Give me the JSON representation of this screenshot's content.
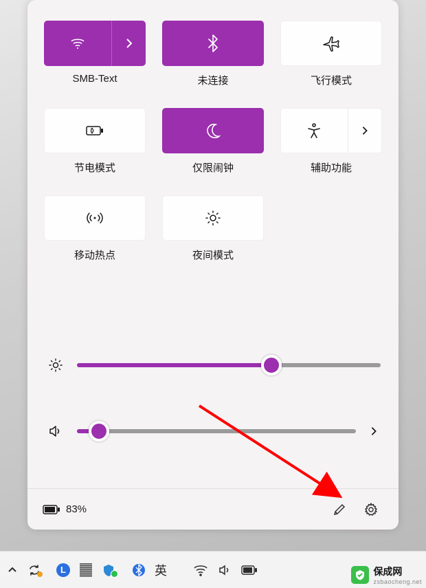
{
  "tiles": [
    {
      "label": "SMB-Text",
      "icon": "wifi",
      "state": "on",
      "split": true
    },
    {
      "label": "未连接",
      "icon": "bluetooth",
      "state": "on",
      "split": false
    },
    {
      "label": "飞行模式",
      "icon": "airplane",
      "state": "off",
      "split": false
    },
    {
      "label": "节电模式",
      "icon": "battery-saver",
      "state": "off",
      "split": false
    },
    {
      "label": "仅限闹钟",
      "icon": "moon",
      "state": "on",
      "split": false
    },
    {
      "label": "辅助功能",
      "icon": "accessibility",
      "state": "off",
      "split": true
    },
    {
      "label": "移动热点",
      "icon": "hotspot",
      "state": "off",
      "split": false
    },
    {
      "label": "夜间模式",
      "icon": "night-light",
      "state": "off",
      "split": false
    }
  ],
  "sliders": {
    "brightness": {
      "value": 64,
      "icon": "brightness"
    },
    "volume": {
      "value": 8,
      "icon": "volume",
      "expand": true
    }
  },
  "footer": {
    "battery_pct": "83%"
  },
  "taskbar": {
    "ime": "英"
  },
  "watermark": {
    "name": "保成网",
    "url": "zsbaocheng.net"
  },
  "accent": "#9b2fae"
}
